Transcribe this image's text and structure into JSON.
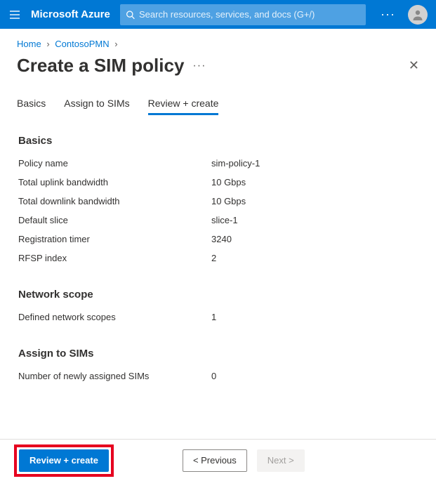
{
  "header": {
    "brand": "Microsoft Azure",
    "search_placeholder": "Search resources, services, and docs (G+/)"
  },
  "breadcrumb": {
    "home": "Home",
    "item": "ContosoPMN"
  },
  "page": {
    "title": "Create a SIM policy"
  },
  "tabs": {
    "basics": "Basics",
    "assign": "Assign to SIMs",
    "review": "Review + create"
  },
  "sections": {
    "basics_heading": "Basics",
    "network_heading": "Network scope",
    "assign_heading": "Assign to SIMs"
  },
  "fields": {
    "policy_name": {
      "label": "Policy name",
      "value": "sim-policy-1"
    },
    "uplink": {
      "label": "Total uplink bandwidth",
      "value": "10 Gbps"
    },
    "downlink": {
      "label": "Total downlink bandwidth",
      "value": "10 Gbps"
    },
    "default_slice": {
      "label": "Default slice",
      "value": "slice-1"
    },
    "reg_timer": {
      "label": "Registration timer",
      "value": "3240"
    },
    "rfsp": {
      "label": "RFSP index",
      "value": "2"
    },
    "scopes": {
      "label": "Defined network scopes",
      "value": "1"
    },
    "assigned_sims": {
      "label": "Number of newly assigned SIMs",
      "value": "0"
    }
  },
  "footer": {
    "review": "Review + create",
    "previous": "<  Previous",
    "next": "Next  >"
  }
}
